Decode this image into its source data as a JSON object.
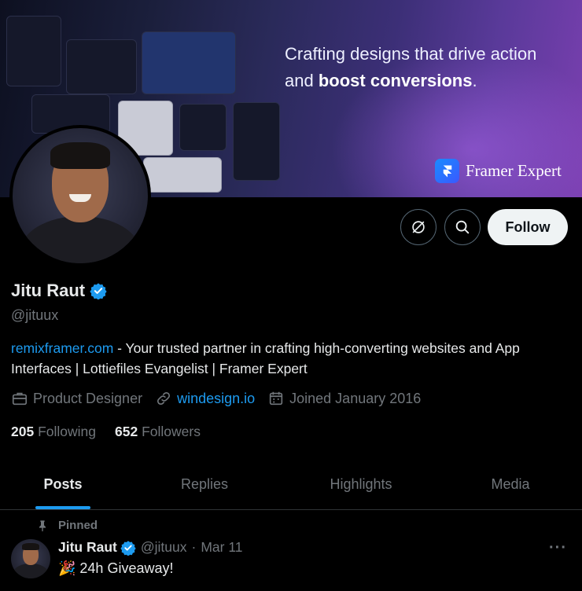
{
  "banner": {
    "tagline_part1": "Crafting designs that drive action",
    "tagline_part2": "and",
    "tagline_bold": "boost conversions",
    "tagline_end": ".",
    "badge_text": "Framer Expert"
  },
  "actions": {
    "follow_label": "Follow"
  },
  "profile": {
    "name": "Jitu Raut",
    "handle": "@jituux",
    "bio_link": "remixframer.com",
    "bio_text": " - Your trusted partner in crafting high-converting websites and App Interfaces | Lottiefiles Evangelist | Framer Expert",
    "profession": "Product Designer",
    "website": "windesign.io",
    "joined": "Joined January 2016",
    "following_count": "205",
    "following_label": "Following",
    "followers_count": "652",
    "followers_label": "Followers"
  },
  "tabs": [
    {
      "label": "Posts"
    },
    {
      "label": "Replies"
    },
    {
      "label": "Highlights"
    },
    {
      "label": "Media"
    }
  ],
  "pinned_post": {
    "pinned_label": "Pinned",
    "author_name": "Jitu Raut",
    "author_handle": "@jituux",
    "separator": "·",
    "date": "Mar 11",
    "text": "🎉 24h Giveaway!",
    "more": "···"
  },
  "colors": {
    "accent": "#1d9bf0",
    "background": "#000000",
    "muted_text": "#71767b"
  }
}
